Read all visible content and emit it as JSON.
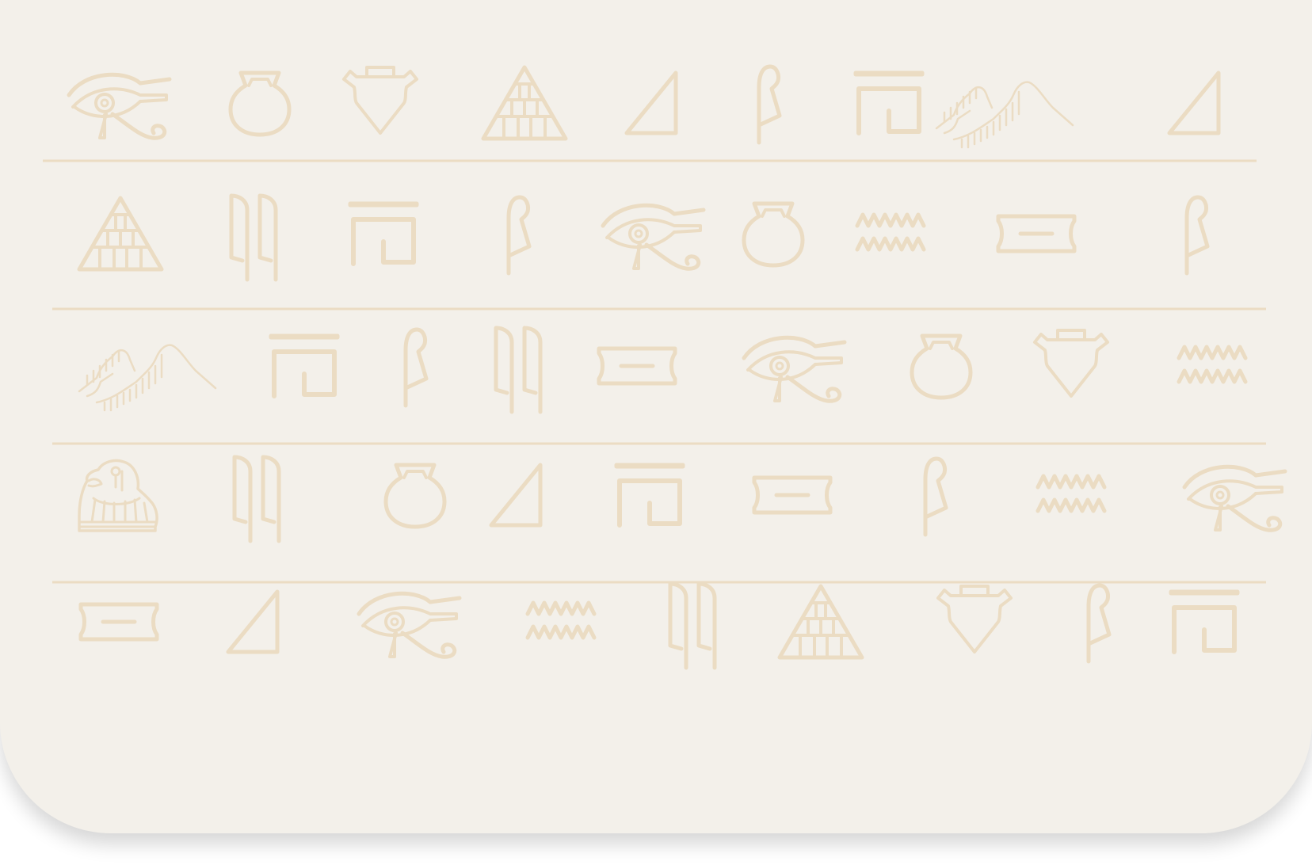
{
  "palette": {
    "background": "#f3f0ea",
    "glyph": "#ebdcc3",
    "divider": "#ebdcc3"
  },
  "rows": [
    [
      "eye",
      "pot",
      "vessel",
      "pyramid",
      "triangle",
      "reed",
      "house",
      "hills",
      "triangle"
    ],
    [
      "pyramid",
      "double-reed",
      "house",
      "reed",
      "eye",
      "pot",
      "water",
      "cartouche",
      "reed"
    ],
    [
      "hills",
      "house",
      "reed",
      "double-reed",
      "cartouche",
      "eye",
      "pot",
      "vessel",
      "water"
    ],
    [
      "falcon",
      "double-reed",
      "pot",
      "triangle",
      "house",
      "cartouche",
      "reed",
      "water",
      "eye"
    ],
    [
      "cartouche",
      "triangle",
      "eye",
      "water",
      "double-reed",
      "pyramid",
      "vessel",
      "reed",
      "house"
    ]
  ]
}
